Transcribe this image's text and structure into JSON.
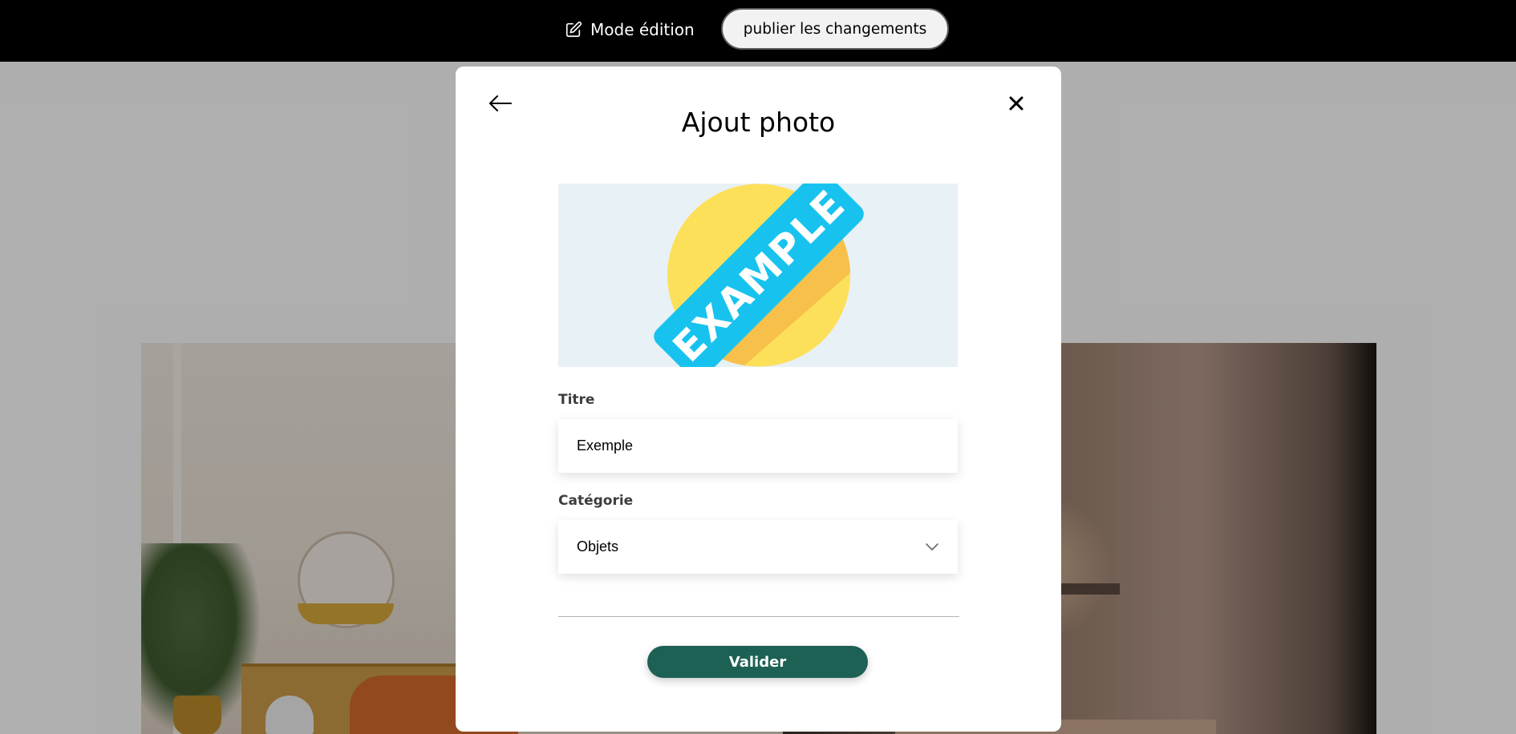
{
  "edit_bar": {
    "mode_label": "Mode édition",
    "mode_icon": "edit-icon",
    "publish_label": "publier les changements",
    "background_color": "#000000"
  },
  "modal": {
    "title": "Ajout photo",
    "back_icon": "arrow-left-icon",
    "close_icon": "close-icon",
    "preview": {
      "image_text": "EXAMPLE",
      "background_color": "#e8f1f6",
      "circle_color": "#fde05a",
      "ribbon_color": "#17c3ee"
    },
    "title_field": {
      "label": "Titre",
      "value": "Exemple"
    },
    "category_field": {
      "label": "Catégorie",
      "selected": "Objets",
      "icon": "chevron-down-icon"
    },
    "submit_label": "Valider",
    "submit_color": "#1d6154"
  },
  "gallery": {
    "left_photo": "living-room-photo",
    "right_photo": "bedroom-lamp-photo"
  }
}
